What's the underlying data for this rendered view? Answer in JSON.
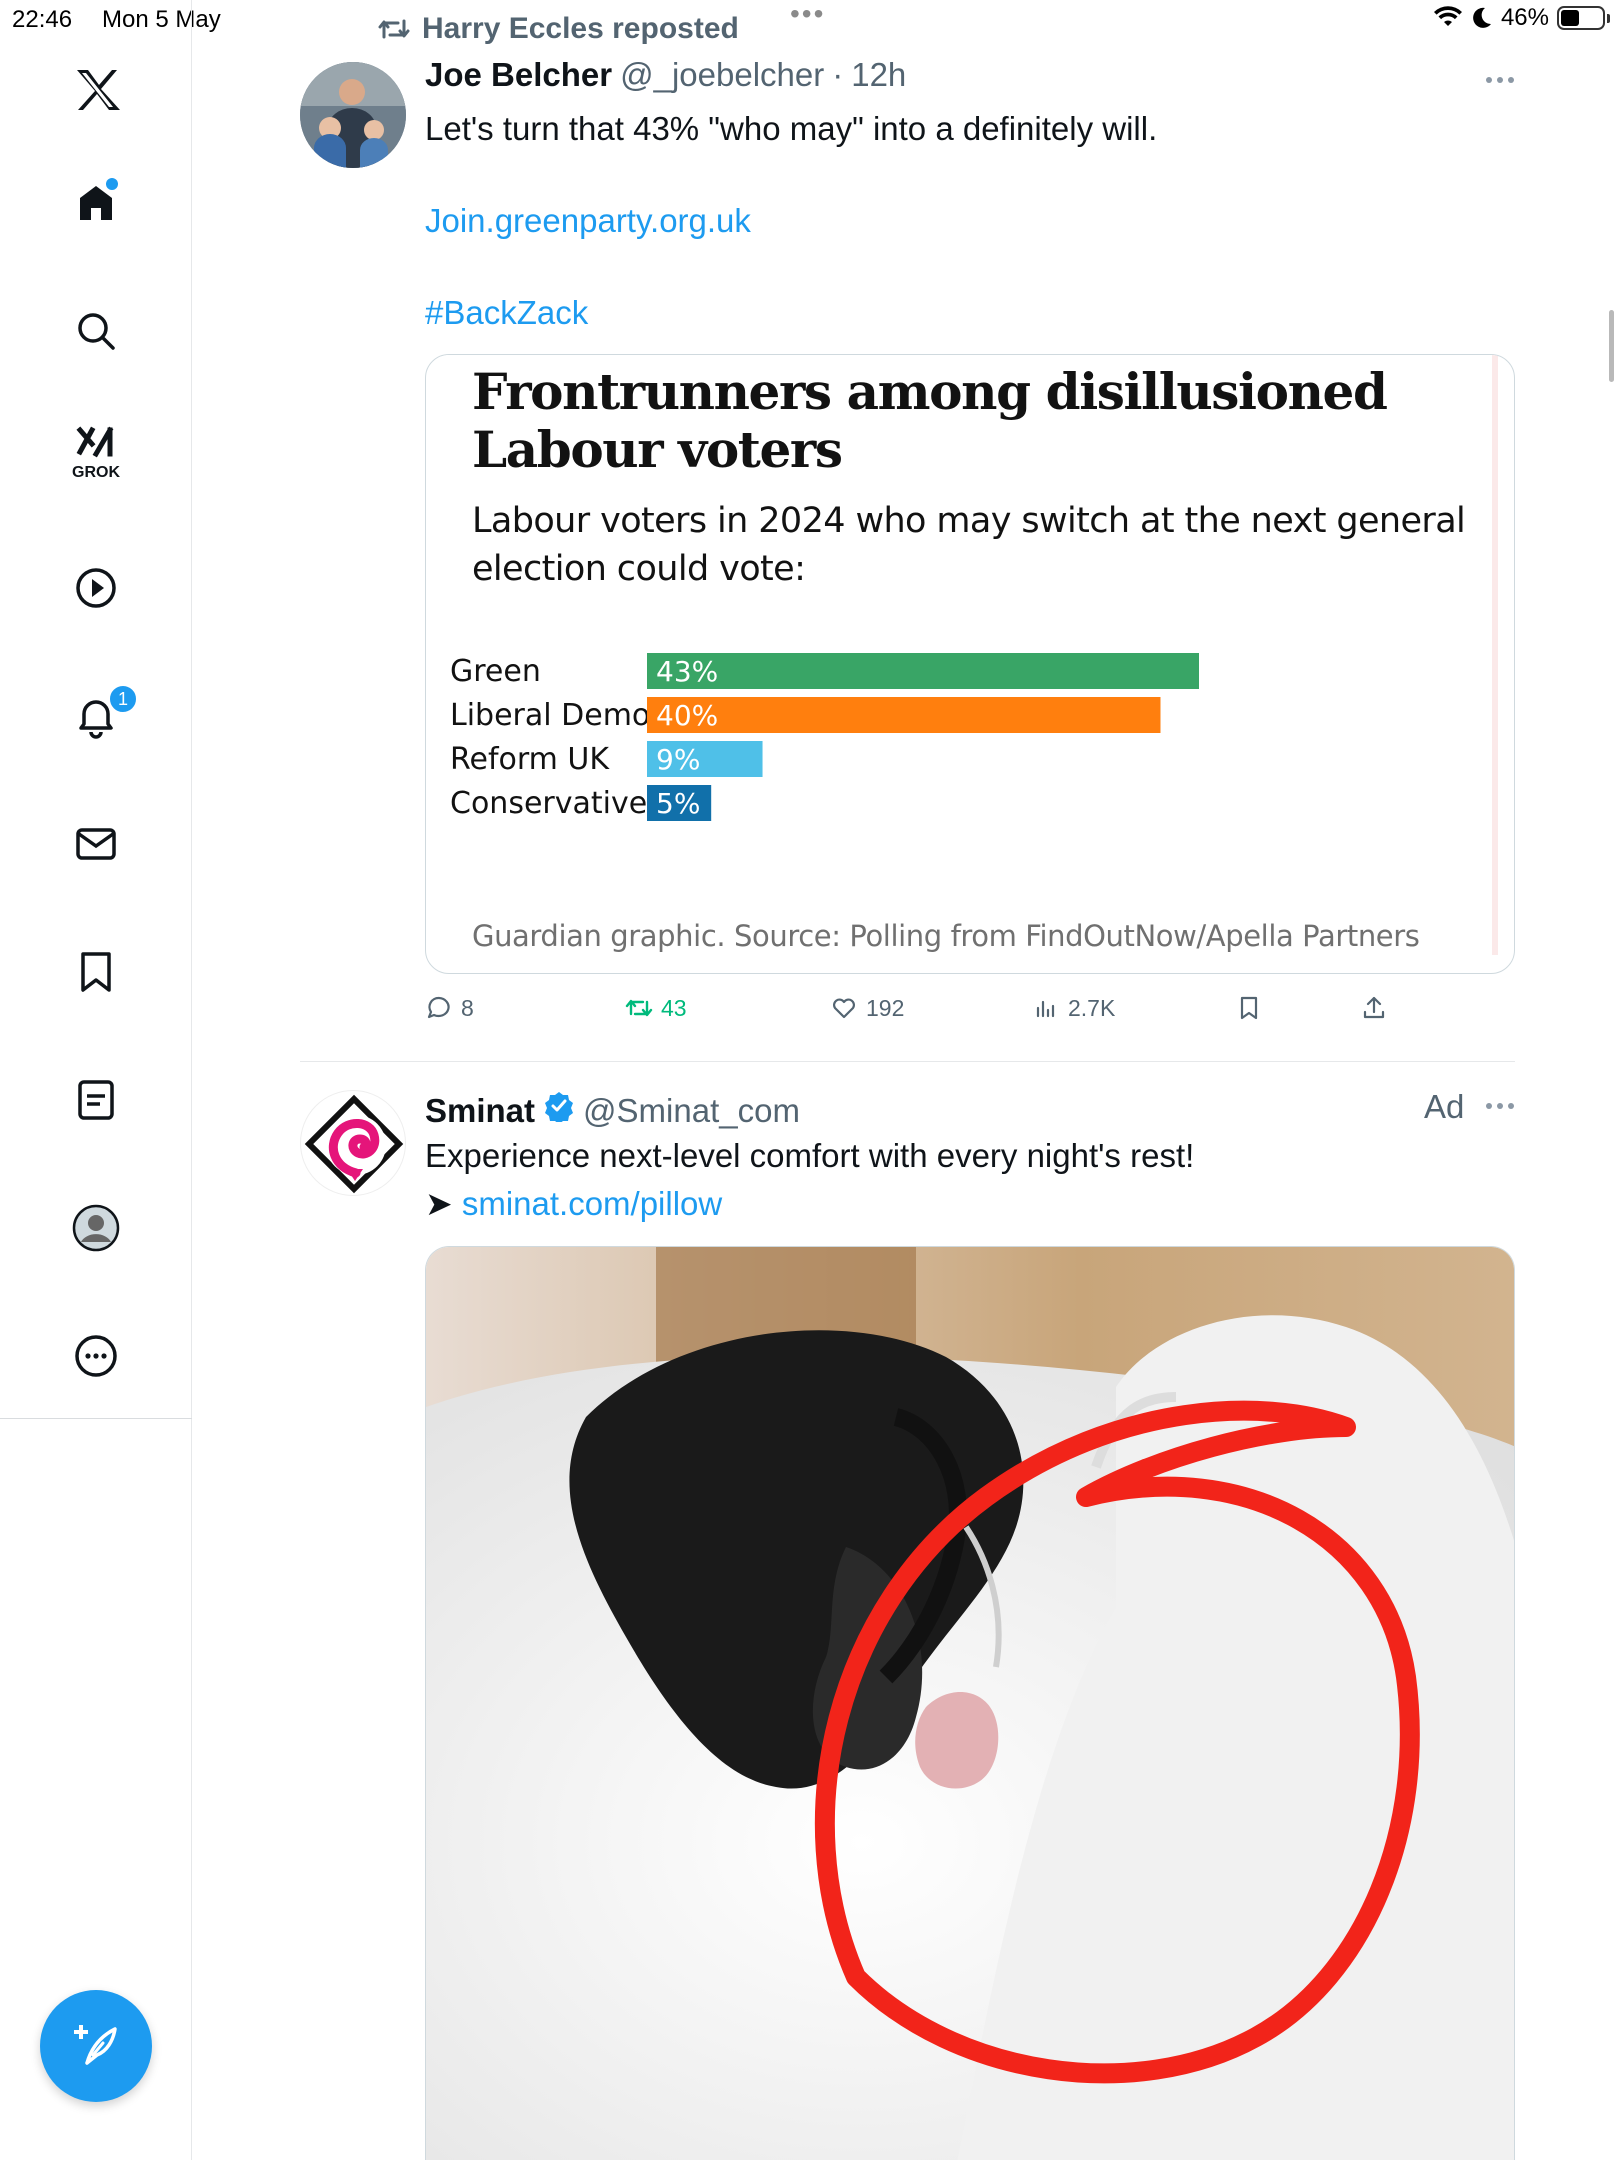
{
  "status_bar": {
    "time": "22:46",
    "date": "Mon 5 May",
    "battery_percent": "46%",
    "battery_level": 0.46
  },
  "sidebar": {
    "items": [
      {
        "icon": "x-logo-icon"
      },
      {
        "icon": "home-icon",
        "has_dot": true
      },
      {
        "icon": "search-icon"
      },
      {
        "icon": "grok-icon",
        "label": "GROK"
      },
      {
        "icon": "video-play-icon"
      },
      {
        "icon": "notifications-bell-icon",
        "badge": "1"
      },
      {
        "icon": "messages-envelope-icon"
      },
      {
        "icon": "bookmarks-icon"
      },
      {
        "icon": "lists-icon"
      },
      {
        "icon": "profile-avatar-icon"
      },
      {
        "icon": "more-icon"
      }
    ],
    "compose_icon": "compose-feather-icon",
    "accent_color": "#1d9bf0"
  },
  "tweet1": {
    "reposted_by": "Harry Eccles reposted",
    "display_name": "Joe Belcher",
    "handle": "@_joebelcher",
    "separator": "·",
    "time_ago": "12h",
    "text_line1": "Let's turn that 43% \"who may\" into a definitely will.",
    "link": "Join.greenparty.org.uk",
    "hashtag": "#BackZack",
    "card": {
      "title": "Frontrunners among disillusioned Labour voters",
      "subtitle": "Labour voters in 2024 who may switch at the next general election could vote:",
      "source": "Guardian graphic. Source: Polling from FindOutNow/Apella Partners"
    },
    "actions": {
      "replies": "8",
      "reposts": "43",
      "likes": "192",
      "views": "2.7K"
    }
  },
  "chart_data": {
    "type": "bar",
    "orientation": "horizontal",
    "categories": [
      "Green",
      "Liberal Democrat",
      "Reform UK",
      "Conservative"
    ],
    "values": [
      43,
      40,
      9,
      5
    ],
    "value_labels": [
      "43%",
      "40%",
      "9%",
      "5%"
    ],
    "colors": [
      "#39a566",
      "#ff7f0e",
      "#4fc0e8",
      "#1170aa"
    ],
    "xlim": [
      0,
      43
    ],
    "grid": false
  },
  "tweet2": {
    "display_name": "Sminat",
    "handle": "@Sminat_com",
    "ad_label": "Ad",
    "text_line1": "Experience next-level comfort with every night's rest!",
    "arrow": "➤",
    "link": "sminat.com/pillow",
    "brand_color": "#e5157a"
  },
  "colors": {
    "text_primary": "#0f1419",
    "text_secondary": "#536471",
    "link": "#1d9bf0",
    "repost_green": "#00ba7c"
  }
}
